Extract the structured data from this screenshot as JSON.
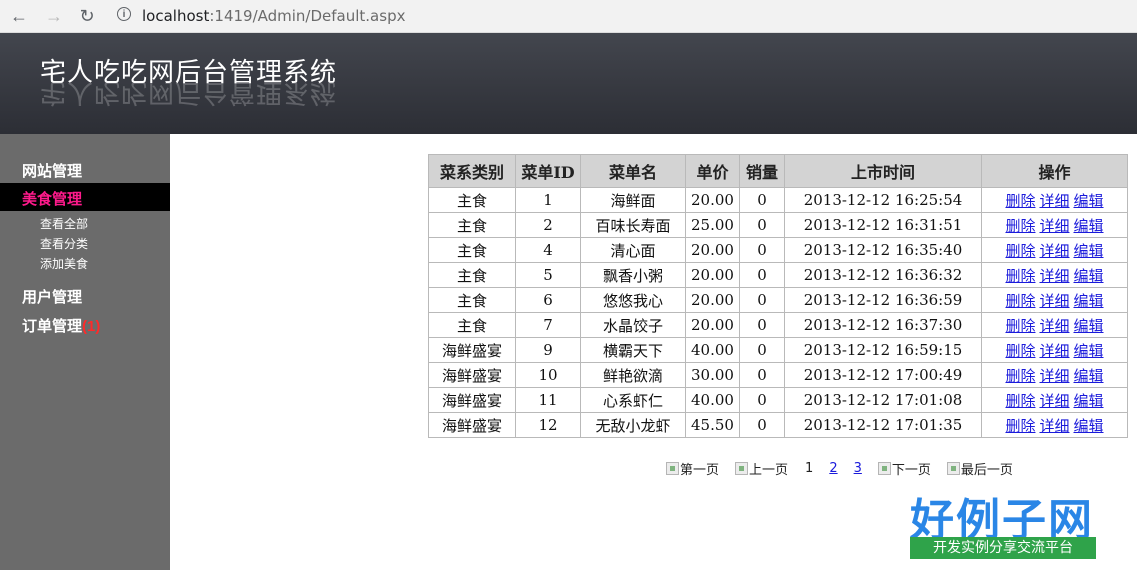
{
  "browser": {
    "url_host": "localhost",
    "url_rest": ":1419/Admin/Default.aspx"
  },
  "header": {
    "title": "宅人吃吃网后台管理系统"
  },
  "sidebar": {
    "site_mgmt": "网站管理",
    "food_mgmt": "美食管理",
    "food_sub": [
      "查看全部",
      "查看分类",
      "添加美食"
    ],
    "user_mgmt": "用户管理",
    "order_mgmt": "订单管理",
    "order_badge": "(1)"
  },
  "table": {
    "headers": [
      "菜系类别",
      "菜单ID",
      "菜单名",
      "单价",
      "销量",
      "上市时间",
      "操作"
    ],
    "actions": [
      "删除",
      "详细",
      "编辑"
    ],
    "rows": [
      [
        "主食",
        "1",
        "海鲜面",
        "20.00",
        "0",
        "2013-12-12 16:25:54"
      ],
      [
        "主食",
        "2",
        "百味长寿面",
        "25.00",
        "0",
        "2013-12-12 16:31:51"
      ],
      [
        "主食",
        "4",
        "清心面",
        "20.00",
        "0",
        "2013-12-12 16:35:40"
      ],
      [
        "主食",
        "5",
        "飘香小粥",
        "20.00",
        "0",
        "2013-12-12 16:36:32"
      ],
      [
        "主食",
        "6",
        "悠悠我心",
        "20.00",
        "0",
        "2013-12-12 16:36:59"
      ],
      [
        "主食",
        "7",
        "水晶饺子",
        "20.00",
        "0",
        "2013-12-12 16:37:30"
      ],
      [
        "海鲜盛宴",
        "9",
        "横霸天下",
        "40.00",
        "0",
        "2013-12-12 16:59:15"
      ],
      [
        "海鲜盛宴",
        "10",
        "鲜艳欲滴",
        "30.00",
        "0",
        "2013-12-12 17:00:49"
      ],
      [
        "海鲜盛宴",
        "11",
        "心系虾仁",
        "40.00",
        "0",
        "2013-12-12 17:01:08"
      ],
      [
        "海鲜盛宴",
        "12",
        "无敌小龙虾",
        "45.50",
        "0",
        "2013-12-12 17:01:35"
      ]
    ]
  },
  "pager": {
    "first": "第一页",
    "prev": "上一页",
    "pages": [
      "1",
      "2",
      "3"
    ],
    "next": "下一页",
    "last": "最后一页"
  },
  "watermark": {
    "logo_text": "好例子网",
    "logo_sub": "开发实例分享交流平台"
  }
}
